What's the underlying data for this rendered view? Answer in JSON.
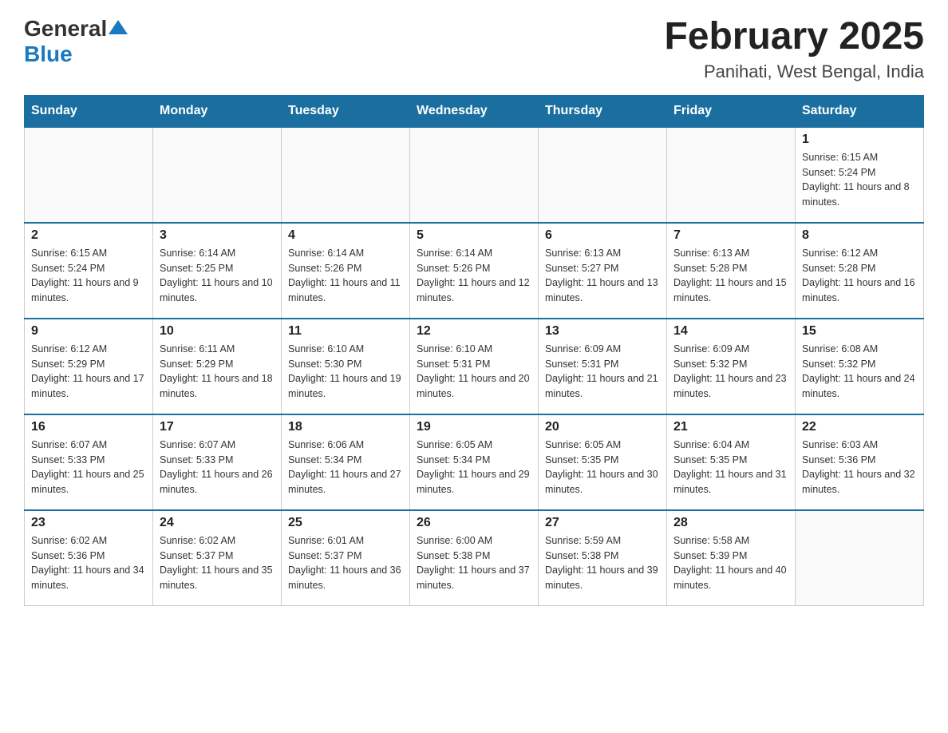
{
  "header": {
    "logo_general": "General",
    "logo_blue": "Blue",
    "title": "February 2025",
    "subtitle": "Panihati, West Bengal, India"
  },
  "weekdays": [
    "Sunday",
    "Monday",
    "Tuesday",
    "Wednesday",
    "Thursday",
    "Friday",
    "Saturday"
  ],
  "weeks": [
    [
      {
        "day": "",
        "info": ""
      },
      {
        "day": "",
        "info": ""
      },
      {
        "day": "",
        "info": ""
      },
      {
        "day": "",
        "info": ""
      },
      {
        "day": "",
        "info": ""
      },
      {
        "day": "",
        "info": ""
      },
      {
        "day": "1",
        "info": "Sunrise: 6:15 AM\nSunset: 5:24 PM\nDaylight: 11 hours and 8 minutes."
      }
    ],
    [
      {
        "day": "2",
        "info": "Sunrise: 6:15 AM\nSunset: 5:24 PM\nDaylight: 11 hours and 9 minutes."
      },
      {
        "day": "3",
        "info": "Sunrise: 6:14 AM\nSunset: 5:25 PM\nDaylight: 11 hours and 10 minutes."
      },
      {
        "day": "4",
        "info": "Sunrise: 6:14 AM\nSunset: 5:26 PM\nDaylight: 11 hours and 11 minutes."
      },
      {
        "day": "5",
        "info": "Sunrise: 6:14 AM\nSunset: 5:26 PM\nDaylight: 11 hours and 12 minutes."
      },
      {
        "day": "6",
        "info": "Sunrise: 6:13 AM\nSunset: 5:27 PM\nDaylight: 11 hours and 13 minutes."
      },
      {
        "day": "7",
        "info": "Sunrise: 6:13 AM\nSunset: 5:28 PM\nDaylight: 11 hours and 15 minutes."
      },
      {
        "day": "8",
        "info": "Sunrise: 6:12 AM\nSunset: 5:28 PM\nDaylight: 11 hours and 16 minutes."
      }
    ],
    [
      {
        "day": "9",
        "info": "Sunrise: 6:12 AM\nSunset: 5:29 PM\nDaylight: 11 hours and 17 minutes."
      },
      {
        "day": "10",
        "info": "Sunrise: 6:11 AM\nSunset: 5:29 PM\nDaylight: 11 hours and 18 minutes."
      },
      {
        "day": "11",
        "info": "Sunrise: 6:10 AM\nSunset: 5:30 PM\nDaylight: 11 hours and 19 minutes."
      },
      {
        "day": "12",
        "info": "Sunrise: 6:10 AM\nSunset: 5:31 PM\nDaylight: 11 hours and 20 minutes."
      },
      {
        "day": "13",
        "info": "Sunrise: 6:09 AM\nSunset: 5:31 PM\nDaylight: 11 hours and 21 minutes."
      },
      {
        "day": "14",
        "info": "Sunrise: 6:09 AM\nSunset: 5:32 PM\nDaylight: 11 hours and 23 minutes."
      },
      {
        "day": "15",
        "info": "Sunrise: 6:08 AM\nSunset: 5:32 PM\nDaylight: 11 hours and 24 minutes."
      }
    ],
    [
      {
        "day": "16",
        "info": "Sunrise: 6:07 AM\nSunset: 5:33 PM\nDaylight: 11 hours and 25 minutes."
      },
      {
        "day": "17",
        "info": "Sunrise: 6:07 AM\nSunset: 5:33 PM\nDaylight: 11 hours and 26 minutes."
      },
      {
        "day": "18",
        "info": "Sunrise: 6:06 AM\nSunset: 5:34 PM\nDaylight: 11 hours and 27 minutes."
      },
      {
        "day": "19",
        "info": "Sunrise: 6:05 AM\nSunset: 5:34 PM\nDaylight: 11 hours and 29 minutes."
      },
      {
        "day": "20",
        "info": "Sunrise: 6:05 AM\nSunset: 5:35 PM\nDaylight: 11 hours and 30 minutes."
      },
      {
        "day": "21",
        "info": "Sunrise: 6:04 AM\nSunset: 5:35 PM\nDaylight: 11 hours and 31 minutes."
      },
      {
        "day": "22",
        "info": "Sunrise: 6:03 AM\nSunset: 5:36 PM\nDaylight: 11 hours and 32 minutes."
      }
    ],
    [
      {
        "day": "23",
        "info": "Sunrise: 6:02 AM\nSunset: 5:36 PM\nDaylight: 11 hours and 34 minutes."
      },
      {
        "day": "24",
        "info": "Sunrise: 6:02 AM\nSunset: 5:37 PM\nDaylight: 11 hours and 35 minutes."
      },
      {
        "day": "25",
        "info": "Sunrise: 6:01 AM\nSunset: 5:37 PM\nDaylight: 11 hours and 36 minutes."
      },
      {
        "day": "26",
        "info": "Sunrise: 6:00 AM\nSunset: 5:38 PM\nDaylight: 11 hours and 37 minutes."
      },
      {
        "day": "27",
        "info": "Sunrise: 5:59 AM\nSunset: 5:38 PM\nDaylight: 11 hours and 39 minutes."
      },
      {
        "day": "28",
        "info": "Sunrise: 5:58 AM\nSunset: 5:39 PM\nDaylight: 11 hours and 40 minutes."
      },
      {
        "day": "",
        "info": ""
      }
    ]
  ]
}
